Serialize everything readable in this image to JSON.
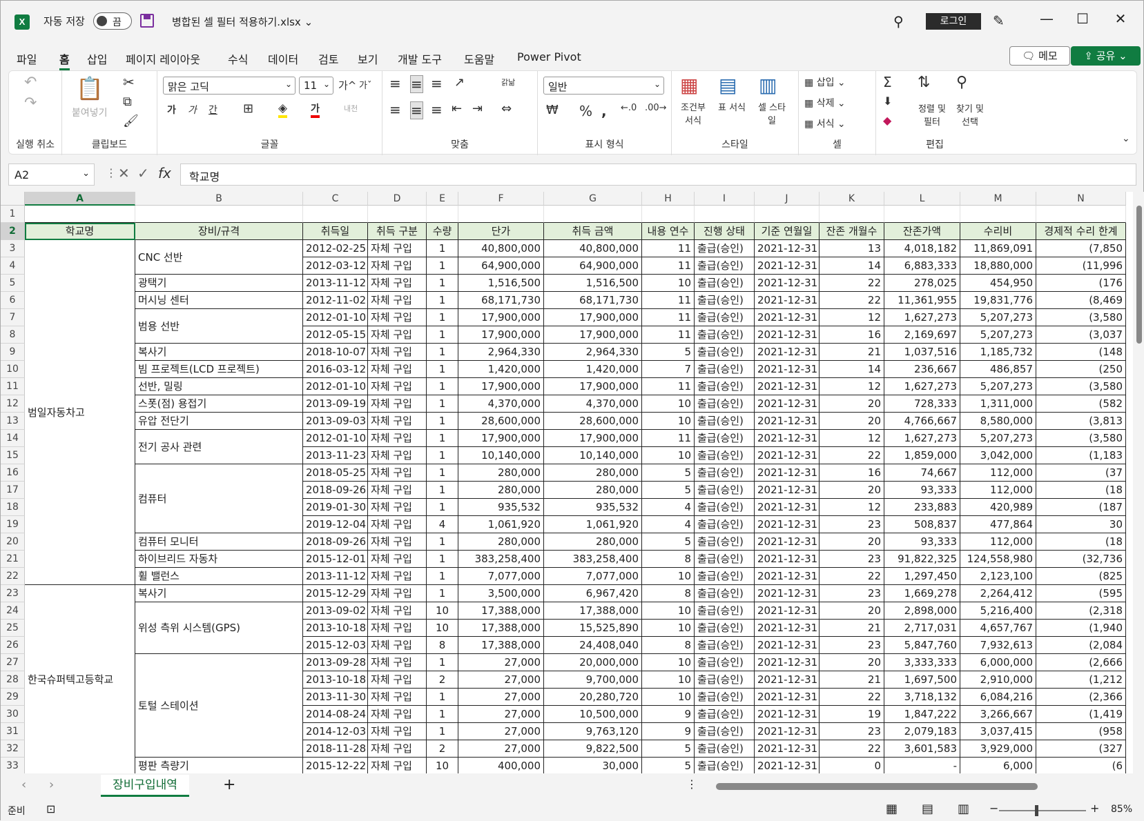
{
  "titlebar": {
    "app_icon": "X",
    "autosave_label": "자동 저장",
    "autosave_state": "끔",
    "filename": "병합된 셀 필터 적용하기.xlsx",
    "login_label": "로그인",
    "icons": [
      "search-icon",
      "pen-icon",
      "minimize-icon",
      "maximize-icon",
      "close-icon"
    ]
  },
  "menu": {
    "tabs": [
      "파일",
      "홈",
      "삽입",
      "페이지 레이아웃",
      "수식",
      "데이터",
      "검토",
      "보기",
      "개발 도구",
      "도움말",
      "Power Pivot"
    ],
    "active": "홈",
    "memo_label": "메모",
    "share_label": "공유"
  },
  "ribbon": {
    "undo_group": "실행 취소",
    "clipboard": {
      "label": "클립보드",
      "paste": "붙여넣기"
    },
    "font": {
      "label": "글꼴",
      "name": "맑은 고딕",
      "size": "11",
      "bold": "가",
      "italic": "가",
      "underline": "간",
      "grow": "가^",
      "shrink": "가ˇ",
      "phonetic": "내천"
    },
    "align": {
      "label": "맞춤",
      "wrap": "갉낢"
    },
    "number": {
      "label": "표시 형식",
      "format": "일반"
    },
    "styles": {
      "label": "스타일",
      "cond": "조건부 서식",
      "table": "표 서식",
      "cell": "셀 스타일"
    },
    "cells": {
      "label": "셀",
      "insert": "삽입",
      "delete": "삭제",
      "format": "서식"
    },
    "edit": {
      "label": "편집",
      "sort": "정렬 및 필터",
      "find": "찾기 및 선택"
    }
  },
  "formula_bar": {
    "name_box": "A2",
    "content": "학교명"
  },
  "columns": [
    "A",
    "B",
    "C",
    "D",
    "E",
    "F",
    "G",
    "H",
    "I",
    "J",
    "K",
    "L",
    "M",
    "N"
  ],
  "headers": [
    "학교명",
    "장비/규격",
    "취득일",
    "취득 구분",
    "수량",
    "단가",
    "취득 금액",
    "내용 연수",
    "진행 상태",
    "기준 연월일",
    "잔존 개월수",
    "잔존가액",
    "수리비",
    "경제적 수리 한계"
  ],
  "groups_a": [
    {
      "label": "범일자동차고",
      "start": 3,
      "end": 22
    },
    {
      "label": "한국슈퍼텍고등학교",
      "start": 23,
      "end": 33
    }
  ],
  "groups_b": [
    {
      "label": "CNC 선반",
      "start": 3,
      "end": 4
    },
    {
      "label": "광택기",
      "start": 5,
      "end": 5
    },
    {
      "label": "머시닝 센터",
      "start": 6,
      "end": 6
    },
    {
      "label": "범용 선반",
      "start": 7,
      "end": 8
    },
    {
      "label": "복사기",
      "start": 9,
      "end": 9
    },
    {
      "label": "빔 프로젝트(LCD 프로젝트)",
      "start": 10,
      "end": 10
    },
    {
      "label": "선반, 밀링",
      "start": 11,
      "end": 11
    },
    {
      "label": "스폿(점) 용접기",
      "start": 12,
      "end": 12
    },
    {
      "label": "유압 전단기",
      "start": 13,
      "end": 13
    },
    {
      "label": "전기 공사 관련",
      "start": 14,
      "end": 15
    },
    {
      "label": "컴퓨터",
      "start": 16,
      "end": 19
    },
    {
      "label": "컴퓨터 모니터",
      "start": 20,
      "end": 20
    },
    {
      "label": "하이브리드 자동차",
      "start": 21,
      "end": 21
    },
    {
      "label": "휠 밸런스",
      "start": 22,
      "end": 22
    },
    {
      "label": "복사기",
      "start": 23,
      "end": 23
    },
    {
      "label": "위성 측위 시스템(GPS)",
      "start": 24,
      "end": 26
    },
    {
      "label": "토털 스테이션",
      "start": 27,
      "end": 32
    },
    {
      "label": "평판 측량기",
      "start": 33,
      "end": 33
    }
  ],
  "rows": [
    [
      "2012-02-25",
      "자체 구입",
      "1",
      "40,800,000",
      "40,800,000",
      "11",
      "출급(승인)",
      "2021-12-31",
      "13",
      "4,018,182",
      "11,869,091",
      "(7,850"
    ],
    [
      "2012-03-12",
      "자체 구입",
      "1",
      "64,900,000",
      "64,900,000",
      "11",
      "출급(승인)",
      "2021-12-31",
      "14",
      "6,883,333",
      "18,880,000",
      "(11,996"
    ],
    [
      "2013-11-12",
      "자체 구입",
      "1",
      "1,516,500",
      "1,516,500",
      "10",
      "출급(승인)",
      "2021-12-31",
      "22",
      "278,025",
      "454,950",
      "(176"
    ],
    [
      "2012-11-02",
      "자체 구입",
      "1",
      "68,171,730",
      "68,171,730",
      "11",
      "출급(승인)",
      "2021-12-31",
      "22",
      "11,361,955",
      "19,831,776",
      "(8,469"
    ],
    [
      "2012-01-10",
      "자체 구입",
      "1",
      "17,900,000",
      "17,900,000",
      "11",
      "출급(승인)",
      "2021-12-31",
      "12",
      "1,627,273",
      "5,207,273",
      "(3,580"
    ],
    [
      "2012-05-15",
      "자체 구입",
      "1",
      "17,900,000",
      "17,900,000",
      "11",
      "출급(승인)",
      "2021-12-31",
      "16",
      "2,169,697",
      "5,207,273",
      "(3,037"
    ],
    [
      "2018-10-07",
      "자체 구입",
      "1",
      "2,964,330",
      "2,964,330",
      "5",
      "출급(승인)",
      "2021-12-31",
      "21",
      "1,037,516",
      "1,185,732",
      "(148"
    ],
    [
      "2016-03-12",
      "자체 구입",
      "1",
      "1,420,000",
      "1,420,000",
      "7",
      "출급(승인)",
      "2021-12-31",
      "14",
      "236,667",
      "486,857",
      "(250"
    ],
    [
      "2012-01-10",
      "자체 구입",
      "1",
      "17,900,000",
      "17,900,000",
      "11",
      "출급(승인)",
      "2021-12-31",
      "12",
      "1,627,273",
      "5,207,273",
      "(3,580"
    ],
    [
      "2013-09-19",
      "자체 구입",
      "1",
      "4,370,000",
      "4,370,000",
      "10",
      "출급(승인)",
      "2021-12-31",
      "20",
      "728,333",
      "1,311,000",
      "(582"
    ],
    [
      "2013-09-03",
      "자체 구입",
      "1",
      "28,600,000",
      "28,600,000",
      "10",
      "출급(승인)",
      "2021-12-31",
      "20",
      "4,766,667",
      "8,580,000",
      "(3,813"
    ],
    [
      "2012-01-10",
      "자체 구입",
      "1",
      "17,900,000",
      "17,900,000",
      "11",
      "출급(승인)",
      "2021-12-31",
      "12",
      "1,627,273",
      "5,207,273",
      "(3,580"
    ],
    [
      "2013-11-23",
      "자체 구입",
      "1",
      "10,140,000",
      "10,140,000",
      "10",
      "출급(승인)",
      "2021-12-31",
      "22",
      "1,859,000",
      "3,042,000",
      "(1,183"
    ],
    [
      "2018-05-25",
      "자체 구입",
      "1",
      "280,000",
      "280,000",
      "5",
      "출급(승인)",
      "2021-12-31",
      "16",
      "74,667",
      "112,000",
      "(37"
    ],
    [
      "2018-09-26",
      "자체 구입",
      "1",
      "280,000",
      "280,000",
      "5",
      "출급(승인)",
      "2021-12-31",
      "20",
      "93,333",
      "112,000",
      "(18"
    ],
    [
      "2019-01-30",
      "자체 구입",
      "1",
      "935,532",
      "935,532",
      "4",
      "출급(승인)",
      "2021-12-31",
      "12",
      "233,883",
      "420,989",
      "(187"
    ],
    [
      "2019-12-04",
      "자체 구입",
      "4",
      "1,061,920",
      "1,061,920",
      "4",
      "출급(승인)",
      "2021-12-31",
      "23",
      "508,837",
      "477,864",
      "30"
    ],
    [
      "2018-09-26",
      "자체 구입",
      "1",
      "280,000",
      "280,000",
      "5",
      "출급(승인)",
      "2021-12-31",
      "20",
      "93,333",
      "112,000",
      "(18"
    ],
    [
      "2015-12-01",
      "자체 구입",
      "1",
      "383,258,400",
      "383,258,400",
      "8",
      "출급(승인)",
      "2021-12-31",
      "23",
      "91,822,325",
      "124,558,980",
      "(32,736"
    ],
    [
      "2013-11-12",
      "자체 구입",
      "1",
      "7,077,000",
      "7,077,000",
      "10",
      "출급(승인)",
      "2021-12-31",
      "22",
      "1,297,450",
      "2,123,100",
      "(825"
    ],
    [
      "2015-12-29",
      "자체 구입",
      "1",
      "3,500,000",
      "6,967,420",
      "8",
      "출급(승인)",
      "2021-12-31",
      "23",
      "1,669,278",
      "2,264,412",
      "(595"
    ],
    [
      "2013-09-02",
      "자체 구입",
      "10",
      "17,388,000",
      "17,388,000",
      "10",
      "출급(승인)",
      "2021-12-31",
      "20",
      "2,898,000",
      "5,216,400",
      "(2,318"
    ],
    [
      "2013-10-18",
      "자체 구입",
      "10",
      "17,388,000",
      "15,525,890",
      "10",
      "출급(승인)",
      "2021-12-31",
      "21",
      "2,717,031",
      "4,657,767",
      "(1,940"
    ],
    [
      "2015-12-03",
      "자체 구입",
      "8",
      "17,388,000",
      "24,408,040",
      "8",
      "출급(승인)",
      "2021-12-31",
      "23",
      "5,847,760",
      "7,932,613",
      "(2,084"
    ],
    [
      "2013-09-28",
      "자체 구입",
      "1",
      "27,000",
      "20,000,000",
      "10",
      "출급(승인)",
      "2021-12-31",
      "20",
      "3,333,333",
      "6,000,000",
      "(2,666"
    ],
    [
      "2013-10-18",
      "자체 구입",
      "2",
      "27,000",
      "9,700,000",
      "10",
      "출급(승인)",
      "2021-12-31",
      "21",
      "1,697,500",
      "2,910,000",
      "(1,212"
    ],
    [
      "2013-11-30",
      "자체 구입",
      "1",
      "27,000",
      "20,280,720",
      "10",
      "출급(승인)",
      "2021-12-31",
      "22",
      "3,718,132",
      "6,084,216",
      "(2,366"
    ],
    [
      "2014-08-24",
      "자체 구입",
      "1",
      "27,000",
      "10,500,000",
      "9",
      "출급(승인)",
      "2021-12-31",
      "19",
      "1,847,222",
      "3,266,667",
      "(1,419"
    ],
    [
      "2014-12-03",
      "자체 구입",
      "1",
      "27,000",
      "9,763,120",
      "9",
      "출급(승인)",
      "2021-12-31",
      "23",
      "2,079,183",
      "3,037,415",
      "(958"
    ],
    [
      "2018-11-28",
      "자체 구입",
      "2",
      "27,000",
      "9,822,500",
      "5",
      "출급(승인)",
      "2021-12-31",
      "22",
      "3,601,583",
      "3,929,000",
      "(327"
    ],
    [
      "2015-12-22",
      "자체 구입",
      "10",
      "400,000",
      "30,000",
      "5",
      "출급(승인)",
      "2021-12-31",
      "0",
      "-",
      "6,000",
      "(6"
    ]
  ],
  "sheet_tabs": [
    "장비구입내역"
  ],
  "status": {
    "ready": "준비",
    "zoom": "85%"
  }
}
